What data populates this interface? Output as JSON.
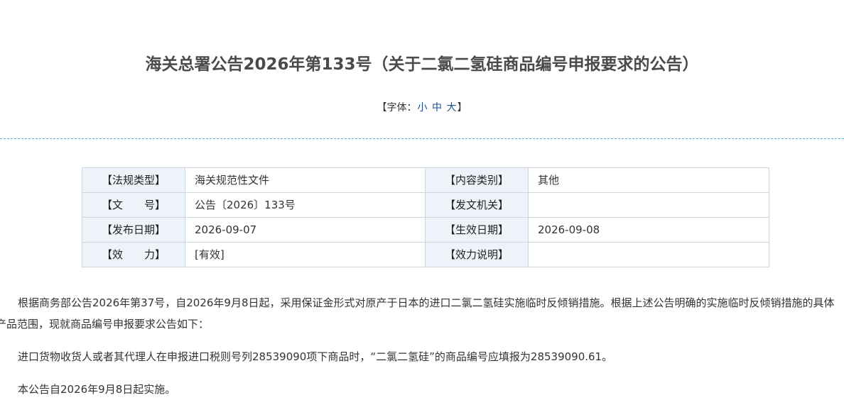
{
  "title": "海关总署公告2026年第133号（关于二氯二氢硅商品编号申报要求的公告）",
  "font_size": {
    "open": "【字体：",
    "small": "小",
    "medium": "中",
    "large": "大",
    "close": "】"
  },
  "meta": {
    "rows": [
      {
        "label1": "【法规类型】",
        "value1": "海关规范性文件",
        "label2": "【内容类别】",
        "value2": "其他"
      },
      {
        "label1": "【文　　号】",
        "value1": "公告〔2026〕133号",
        "label2": "【发文机关】",
        "value2": ""
      },
      {
        "label1": "【发布日期】",
        "value1": "2026-09-07",
        "label2": "【生效日期】",
        "value2": "2026-09-08"
      },
      {
        "label1": "【效　　力】",
        "value1": "[有效]",
        "label2": "【效力说明】",
        "value2": ""
      }
    ]
  },
  "body": {
    "paragraphs": [
      "根据商务部公告2026年第37号，自2026年9月8日起，采用保证金形式对原产于日本的进口二氯二氢硅实施临时反倾销措施。根据上述公告明确的实施临时反倾销措施的具体产品范围，现就商品编号申报要求公告如下：",
      "进口货物收货人或者其代理人在申报进口税则号列28539090项下商品时，“二氯二氢硅”的商品编号应填报为28539090.61。",
      "本公告自2026年9月8日起实施。"
    ]
  }
}
